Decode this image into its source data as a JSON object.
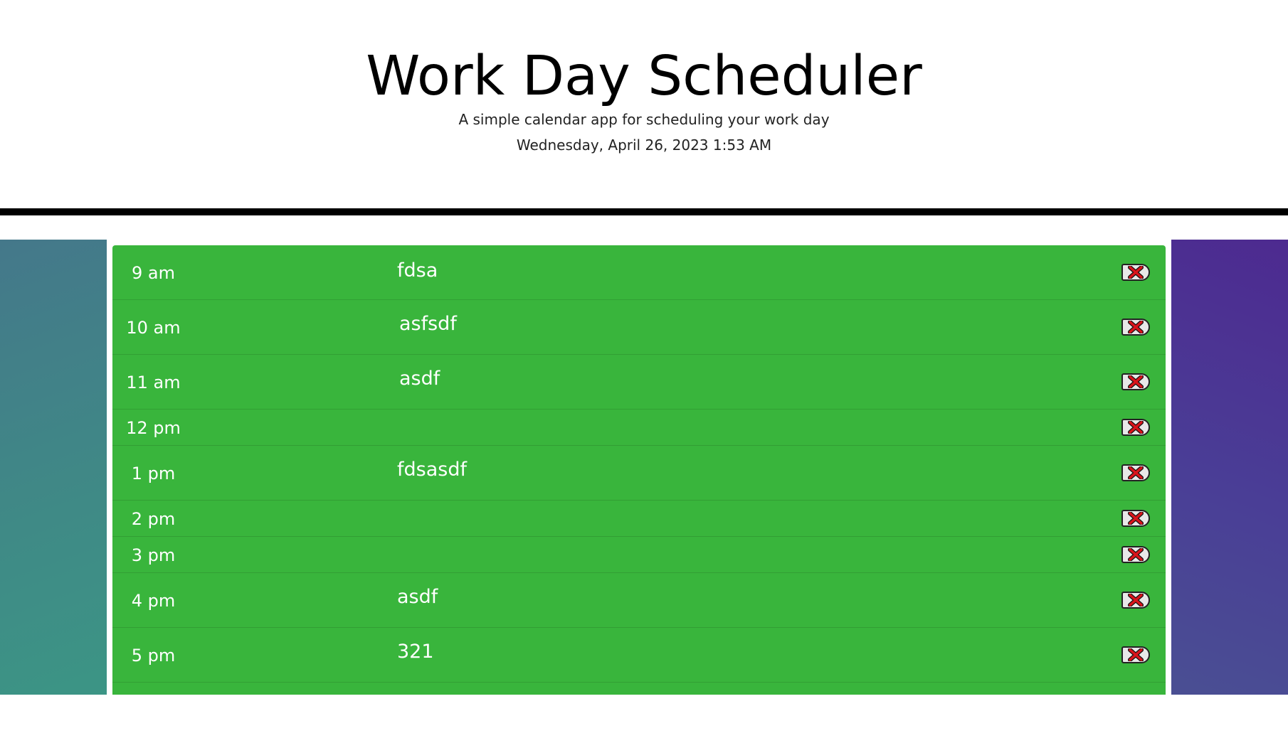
{
  "header": {
    "title": "Work Day Scheduler",
    "subtitle": "A simple calendar app for scheduling your work day",
    "datetime": "Wednesday, April 26, 2023 1:53 AM"
  },
  "colors": {
    "row_present": "#39b53c",
    "text": "#ffffff"
  },
  "rows": [
    {
      "hour": "9 am",
      "note": "fdsa"
    },
    {
      "hour": "10 am",
      "note": "asfsdf"
    },
    {
      "hour": "11 am",
      "note": "asdf"
    },
    {
      "hour": "12 pm",
      "note": ""
    },
    {
      "hour": "1 pm",
      "note": "fdsasdf"
    },
    {
      "hour": "2 pm",
      "note": ""
    },
    {
      "hour": "3 pm",
      "note": ""
    },
    {
      "hour": "4 pm",
      "note": "asdf"
    },
    {
      "hour": "5 pm",
      "note": "321"
    }
  ],
  "icons": {
    "delete": "close-x-icon"
  }
}
